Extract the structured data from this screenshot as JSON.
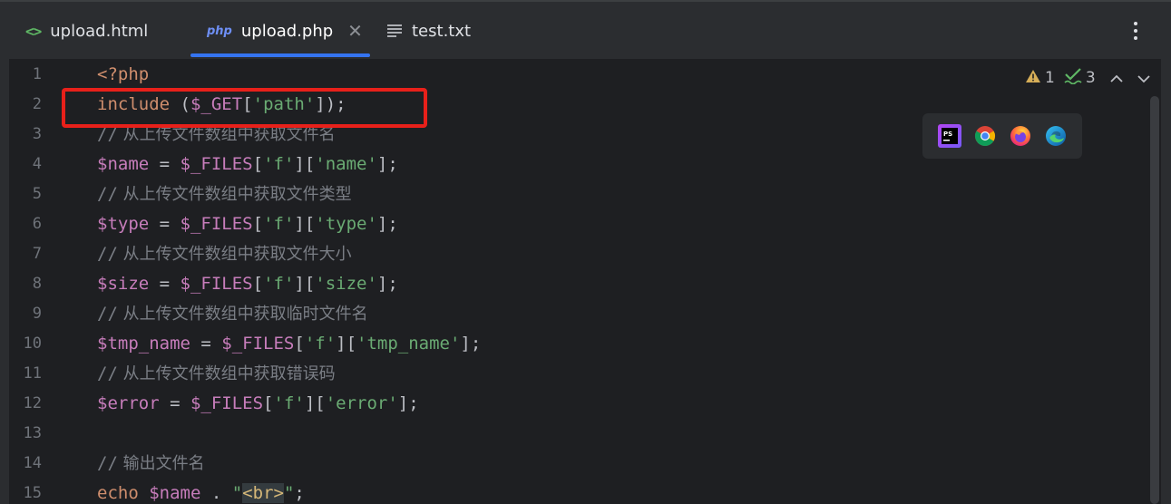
{
  "tabs": [
    {
      "label": "upload.html",
      "icon": "html-file-icon",
      "active": false
    },
    {
      "label": "upload.php",
      "icon": "php-file-icon",
      "active": true
    },
    {
      "label": "test.txt",
      "icon": "text-file-icon",
      "active": false
    }
  ],
  "inspections": {
    "warnings": "1",
    "checks": "3"
  },
  "browsers": [
    "phpstorm-icon",
    "chrome-icon",
    "firefox-icon",
    "edge-icon"
  ],
  "line_numbers": [
    "1",
    "2",
    "3",
    "4",
    "5",
    "6",
    "7",
    "8",
    "9",
    "10",
    "11",
    "12",
    "13",
    "14",
    "15"
  ],
  "code": {
    "l1": "<?php",
    "l2": {
      "kw": "include",
      "p1": " (",
      "var": "$_GET",
      "p2": "[",
      "str": "'path'",
      "p3": "]);"
    },
    "l3": {
      "slash": "//",
      "text": " 从上传文件数组中获取文件名"
    },
    "l4": {
      "var": "$name",
      "eq": " = ",
      "files": "$_FILES",
      "b1": "[",
      "s1": "'f'",
      "b2": "][",
      "s2": "'name'",
      "b3": "];"
    },
    "l5": {
      "slash": "//",
      "text": " 从上传文件数组中获取文件类型"
    },
    "l6": {
      "var": "$type",
      "eq": " = ",
      "files": "$_FILES",
      "b1": "[",
      "s1": "'f'",
      "b2": "][",
      "s2": "'type'",
      "b3": "];"
    },
    "l7": {
      "slash": "//",
      "text": " 从上传文件数组中获取文件大小"
    },
    "l8": {
      "var": "$size",
      "eq": " = ",
      "files": "$_FILES",
      "b1": "[",
      "s1": "'f'",
      "b2": "][",
      "s2": "'size'",
      "b3": "];"
    },
    "l9": {
      "slash": "//",
      "text": " 从上传文件数组中获取临时文件名"
    },
    "l10": {
      "var": "$tmp_name",
      "eq": " = ",
      "files": "$_FILES",
      "b1": "[",
      "s1": "'f'",
      "b2": "][",
      "s2": "'tmp_name'",
      "b3": "];"
    },
    "l11": {
      "slash": "//",
      "text": " 从上传文件数组中获取错误码"
    },
    "l12": {
      "var": "$error",
      "eq": " = ",
      "files": "$_FILES",
      "b1": "[",
      "s1": "'f'",
      "b2": "][",
      "s2": "'error'",
      "b3": "];"
    },
    "l14": {
      "slash": "//",
      "text": " 输出文件名"
    },
    "l15": {
      "kw": "echo",
      "sp": " ",
      "var": "$name",
      "dot": " . ",
      "q1": "\"",
      "html": "<br>",
      "q2": "\"",
      "end": ";"
    }
  },
  "colors": {
    "highlight_box": "#e8201a",
    "active_tab_underline": "#3574f0",
    "editor_bg": "#1e1f22"
  }
}
